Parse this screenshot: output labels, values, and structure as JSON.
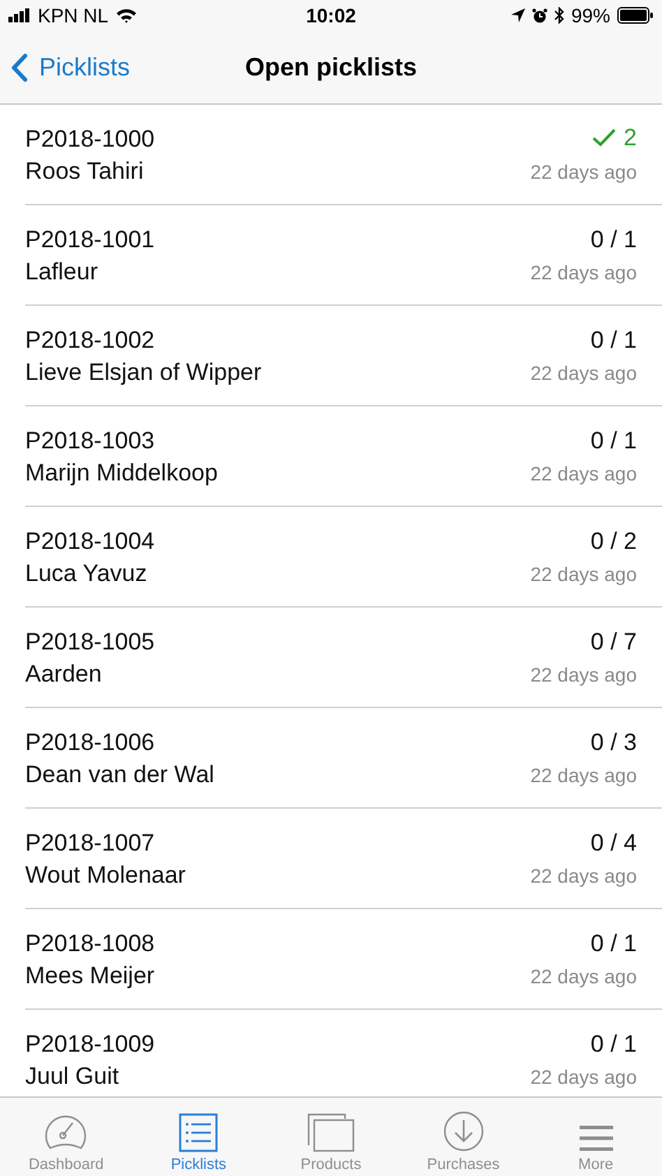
{
  "status_bar": {
    "carrier": "KPN NL",
    "time": "10:02",
    "battery": "99%"
  },
  "nav": {
    "back": "Picklists",
    "title": "Open picklists"
  },
  "picklists": [
    {
      "number": "P2018-1000",
      "customer": "Roos Tahiri",
      "count": "2",
      "age": "22 days ago",
      "done": true
    },
    {
      "number": "P2018-1001",
      "customer": "Lafleur",
      "count": "0 / 1",
      "age": "22 days ago",
      "done": false
    },
    {
      "number": "P2018-1002",
      "customer": "Lieve Elsjan of Wipper",
      "count": "0 / 1",
      "age": "22 days ago",
      "done": false
    },
    {
      "number": "P2018-1003",
      "customer": "Marijn Middelkoop",
      "count": "0 / 1",
      "age": "22 days ago",
      "done": false
    },
    {
      "number": "P2018-1004",
      "customer": "Luca Yavuz",
      "count": "0 / 2",
      "age": "22 days ago",
      "done": false
    },
    {
      "number": "P2018-1005",
      "customer": "Aarden",
      "count": "0 / 7",
      "age": "22 days ago",
      "done": false
    },
    {
      "number": "P2018-1006",
      "customer": "Dean van der Wal",
      "count": "0 / 3",
      "age": "22 days ago",
      "done": false
    },
    {
      "number": "P2018-1007",
      "customer": "Wout Molenaar",
      "count": "0 / 4",
      "age": "22 days ago",
      "done": false
    },
    {
      "number": "P2018-1008",
      "customer": "Mees Meijer",
      "count": "0 / 1",
      "age": "22 days ago",
      "done": false
    },
    {
      "number": "P2018-1009",
      "customer": "Juul Guit",
      "count": "0 / 1",
      "age": "22 days ago",
      "done": false
    }
  ],
  "tabs": [
    {
      "label": "Dashboard",
      "selected": false
    },
    {
      "label": "Picklists",
      "selected": true
    },
    {
      "label": "Products",
      "selected": false
    },
    {
      "label": "Purchases",
      "selected": false
    },
    {
      "label": "More",
      "selected": false
    }
  ]
}
